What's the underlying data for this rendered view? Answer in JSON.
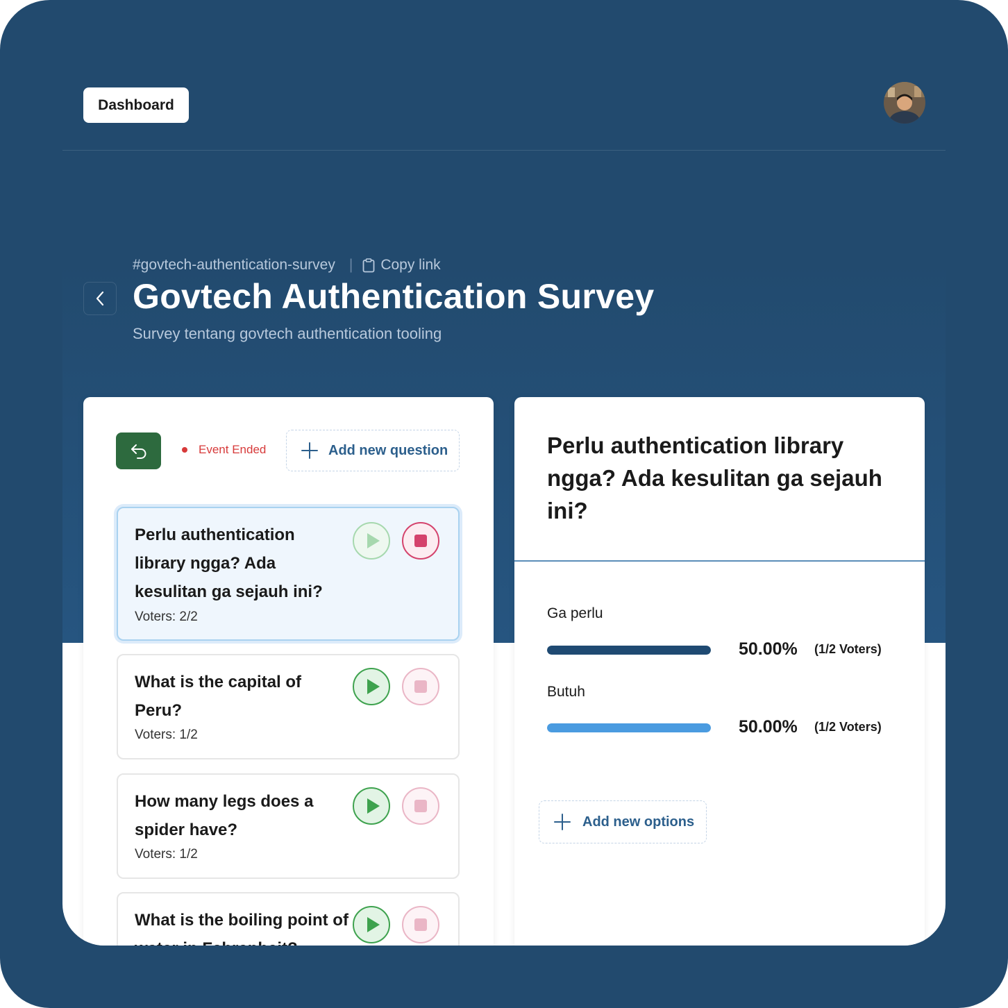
{
  "header": {
    "dashboard_label": "Dashboard",
    "avatar_alt": "user-avatar"
  },
  "survey": {
    "slug": "#govtech-authentication-survey",
    "copy_link_label": "Copy link",
    "title": "Govtech Authentication Survey",
    "subtitle": "Survey tentang govtech authentication tooling"
  },
  "questions_panel": {
    "status": "Event Ended",
    "add_question_label": "Add new question",
    "questions": [
      {
        "text": "Perlu authentication library ngga? Ada kesulitan ga sejauh ini?",
        "voters": "Voters: 2/2",
        "active": true
      },
      {
        "text": "What is the capital of Peru?",
        "voters": "Voters: 1/2",
        "active": false
      },
      {
        "text": "How many legs does a spider have?",
        "voters": "Voters: 1/2",
        "active": false
      },
      {
        "text": "What is the boiling point of water in Fahrenheit?",
        "voters": "",
        "active": false
      }
    ]
  },
  "results_panel": {
    "question": "Perlu authentication library ngga? Ada kesulitan ga sejauh ini?",
    "options": [
      {
        "label": "Ga perlu",
        "percent": "50.00%",
        "voters": "(1/2 Voters)",
        "fraction": 0.5,
        "color": "#1f4a72"
      },
      {
        "label": "Butuh",
        "percent": "50.00%",
        "voters": "(1/2 Voters)",
        "fraction": 0.5,
        "color": "#4a9be0"
      }
    ],
    "add_option_label": "Add new options"
  },
  "colors": {
    "brand_navy": "#224a6e",
    "play_green": "#3ea24e",
    "stop_pink": "#d4426c",
    "status_red": "#d73a3a",
    "undo_green": "#2d6a3e"
  }
}
